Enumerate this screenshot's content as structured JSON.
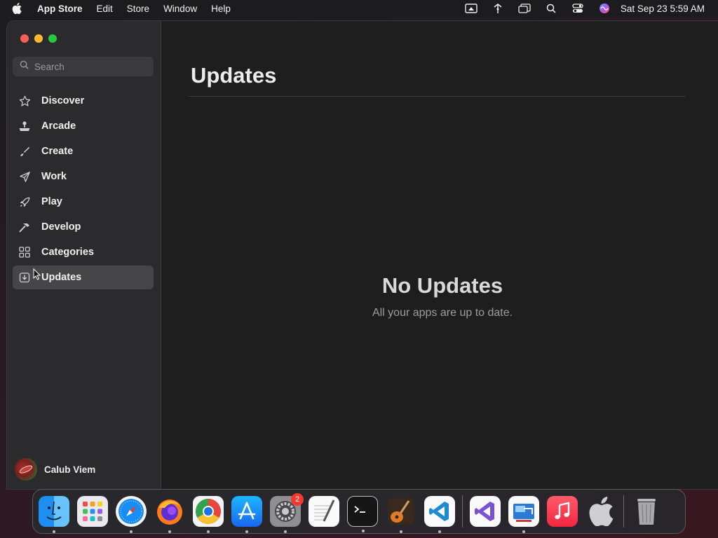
{
  "menubar": {
    "app_name": "App Store",
    "menus": [
      "Edit",
      "Store",
      "Window",
      "Help"
    ],
    "clock": "Sat Sep 23  5:59 AM",
    "status_icons": [
      "screen-mirroring-icon",
      "network-icon",
      "window-icon",
      "spotlight-search-icon",
      "control-center-icon",
      "siri-icon"
    ]
  },
  "sidebar": {
    "search_placeholder": "Search",
    "items": [
      {
        "label": "Discover",
        "icon": "star-icon"
      },
      {
        "label": "Arcade",
        "icon": "joystick-icon"
      },
      {
        "label": "Create",
        "icon": "brush-icon"
      },
      {
        "label": "Work",
        "icon": "paper-plane-icon"
      },
      {
        "label": "Play",
        "icon": "rocket-icon"
      },
      {
        "label": "Develop",
        "icon": "hammer-icon"
      },
      {
        "label": "Categories",
        "icon": "grid-icon"
      },
      {
        "label": "Updates",
        "icon": "download-icon",
        "active": true
      }
    ],
    "user_name": "Calub Viem"
  },
  "main": {
    "title": "Updates",
    "empty_title": "No Updates",
    "empty_subtitle": "All your apps are up to date."
  },
  "dock": {
    "apps": [
      "finder",
      "launchpad",
      "safari",
      "firefox",
      "chrome",
      "app-store",
      "system-settings",
      "textedit",
      "terminal",
      "garageband",
      "vscode",
      "visual-studio",
      "remote-desktop",
      "music",
      "apple-support",
      "trash"
    ],
    "settings_badge": "2"
  },
  "colors": {
    "accent_active": "#464648",
    "sidebar_bg": "#2b2b2d",
    "main_bg": "#1e1e1e"
  }
}
